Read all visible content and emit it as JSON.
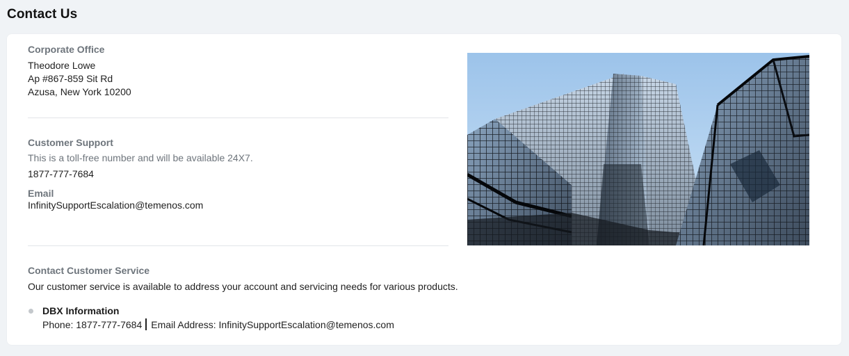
{
  "page": {
    "title": "Contact Us"
  },
  "corporate_office": {
    "heading": "Corporate Office",
    "name": "Theodore Lowe",
    "address_line1": "Ap #867-859 Sit Rd",
    "address_line2": "Azusa, New York 10200"
  },
  "customer_support": {
    "heading": "Customer Support",
    "note": "This is a toll-free number and will be available 24X7.",
    "phone": "1877-777-7684",
    "email_heading": "Email",
    "email": "InfinitySupportEscalation@temenos.com"
  },
  "customer_service": {
    "heading": "Contact Customer Service",
    "description": "Our customer service is available to address your account and servicing needs for various products.",
    "items": [
      {
        "title": "DBX Information",
        "phone_label": "Phone: ",
        "phone": "1877-777-7684",
        "email_label": "Email Address: ",
        "email": "InfinitySupportEscalation@temenos.com"
      }
    ]
  },
  "colors": {
    "page_bg": "#f0f3f6",
    "card_bg": "#ffffff",
    "section_heading": "#6e757c",
    "divider": "#e2e5e8"
  },
  "image": {
    "semantic": "glass-skyscraper-photo"
  }
}
